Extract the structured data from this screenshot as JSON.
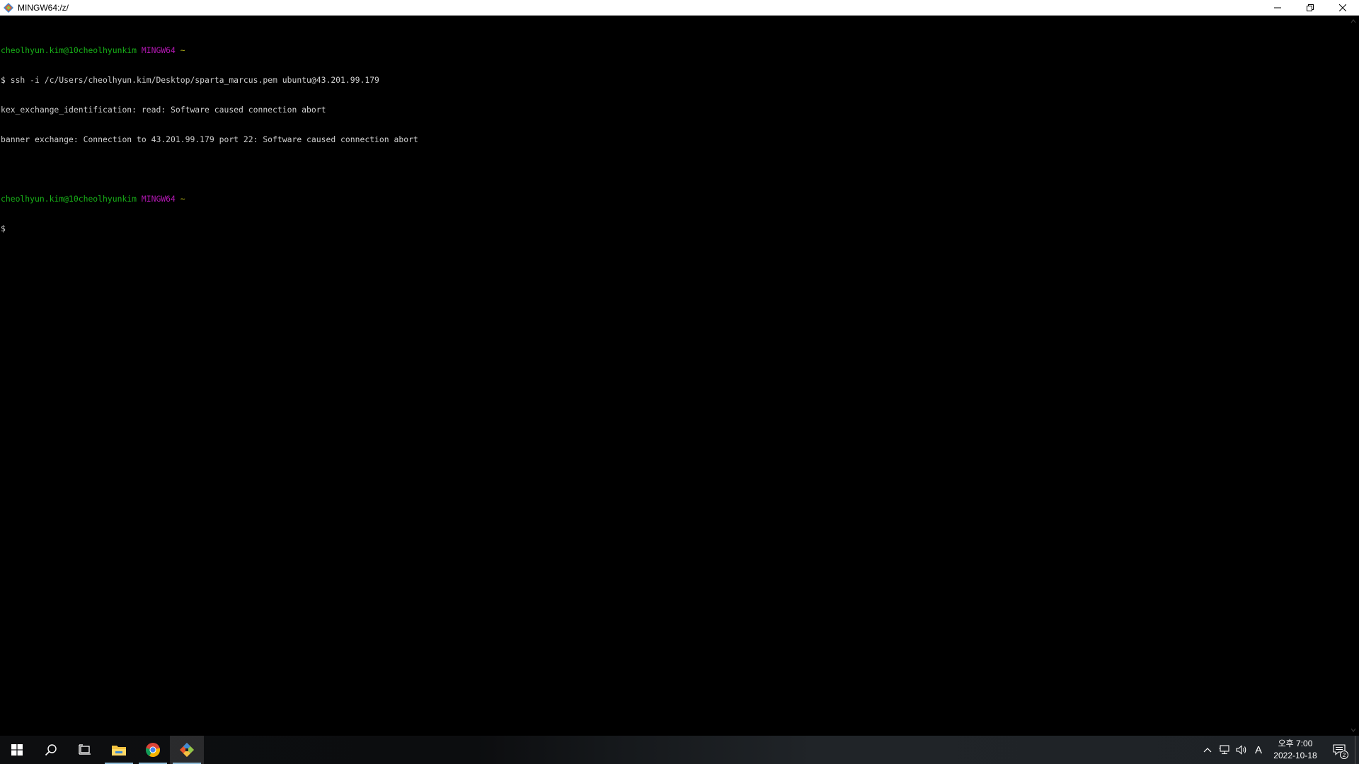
{
  "window": {
    "title": "MINGW64:/z/"
  },
  "terminal": {
    "lines": [
      {
        "user": "cheolhyun.kim@10cheolhyunkim",
        "system": "MINGW64",
        "dir": "~"
      },
      {
        "text": "$ ssh -i /c/Users/cheolhyun.kim/Desktop/sparta_marcus.pem ubuntu@43.201.99.179"
      },
      {
        "text": "kex_exchange_identification: read: Software caused connection abort"
      },
      {
        "text": "banner exchange: Connection to 43.201.99.179 port 22: Software caused connection abort"
      },
      {
        "text": ""
      },
      {
        "user": "cheolhyun.kim@10cheolhyunkim",
        "system": "MINGW64",
        "dir": "~"
      },
      {
        "text": "$"
      }
    ],
    "colors": {
      "user": "#18b218",
      "system": "#b218b2",
      "dir": "#b2b218",
      "text": "#d0d0d0",
      "background": "#000000"
    }
  },
  "taskbar": {
    "apps": [
      "start-icon",
      "search-icon",
      "task-view-icon",
      "file-explorer-icon",
      "chrome-icon",
      "git-bash-icon"
    ],
    "ime_label": "A",
    "clock": {
      "time": "오후 7:00",
      "date": "2022-10-18"
    },
    "notification_count": "2"
  }
}
